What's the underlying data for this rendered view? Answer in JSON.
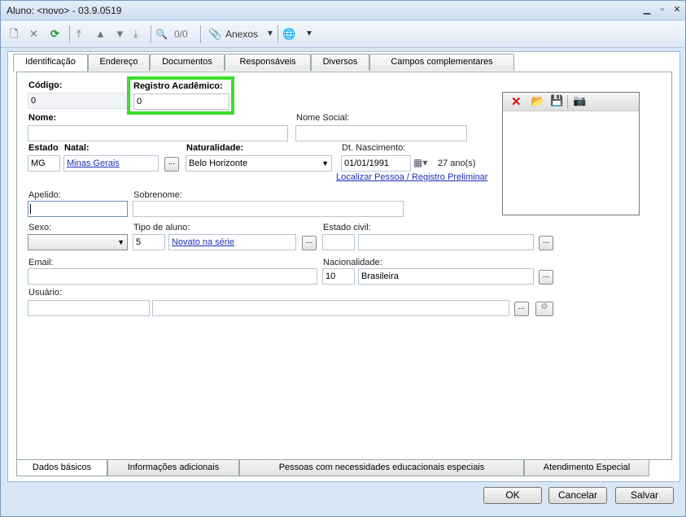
{
  "window": {
    "title": "Aluno: <novo> - 03.9.0519",
    "controls": [
      "minimize-icon",
      "maximize-icon",
      "close-icon"
    ]
  },
  "toolbar": {
    "counter": "0/0",
    "attachments_label": "Anexos"
  },
  "tabs": [
    "Identificação",
    "Endereço",
    "Documentos",
    "Responsáveis",
    "Diversos",
    "Campos complementares"
  ],
  "form": {
    "codigo": {
      "label": "Código:",
      "value": "0"
    },
    "registro": {
      "label": "Registro Acadêmico:",
      "value": "0"
    },
    "nome": {
      "label": "Nome:",
      "value": ""
    },
    "nome_social": {
      "label": "Nome Social:",
      "value": ""
    },
    "estado_natal": {
      "label_a": "Estado",
      "label_b": "Natal:",
      "code": "MG",
      "name": "Minas Gerais"
    },
    "naturalidade": {
      "label": "Naturalidade:",
      "value": "Belo Horizonte"
    },
    "nascimento": {
      "label": "Dt. Nascimento:",
      "value": "01/01/1991",
      "age": "27 ano(s)"
    },
    "localizar_link": "Localizar Pessoa / Registro Preliminar",
    "apelido": {
      "label": "Apelido:",
      "value": ""
    },
    "sobrenome": {
      "label": "Sobrenome:",
      "value": ""
    },
    "sexo": {
      "label": "Sexo:",
      "value": ""
    },
    "tipo_aluno": {
      "label": "Tipo de aluno:",
      "code": "5",
      "name": "Novato na série"
    },
    "estado_civil": {
      "label": "Estado civil:",
      "code": "",
      "name": ""
    },
    "email": {
      "label": "Email:",
      "value": ""
    },
    "nacionalidade": {
      "label": "Nacionalidade:",
      "code": "10",
      "name": "Brasileira"
    },
    "usuario": {
      "label": "Usuário:",
      "value": ""
    },
    "lookup_button": "..."
  },
  "bottom_tabs": [
    "Dados básicos",
    "Informações adicionais",
    "Pessoas com necessidades educacionais especiais",
    "Atendimento Especial"
  ],
  "actions": {
    "ok": "OK",
    "cancel": "Cancelar",
    "save": "Salvar"
  },
  "colors": {
    "highlight": "#3bde28",
    "link": "#1a2fb5",
    "window_bg": "#d9e6f5"
  }
}
